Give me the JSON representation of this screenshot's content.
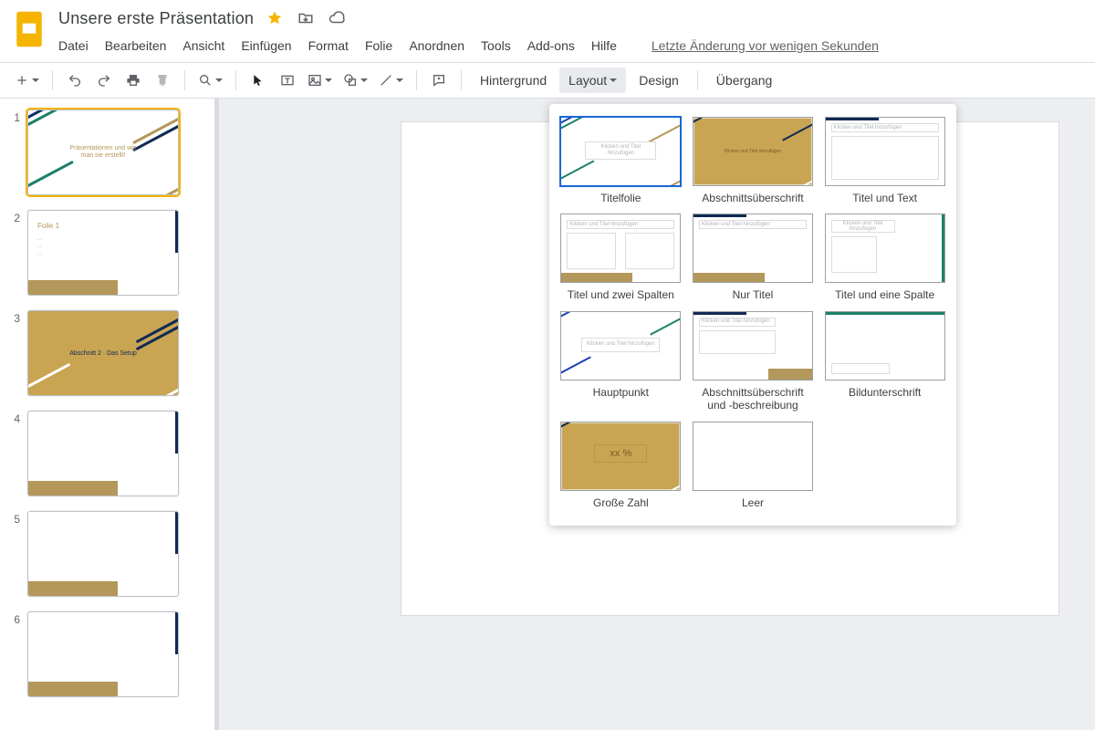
{
  "header": {
    "title": "Unsere erste Präsentation",
    "lastEdit": "Letzte Änderung vor wenigen Sekunden"
  },
  "menu": {
    "file": "Datei",
    "edit": "Bearbeiten",
    "view": "Ansicht",
    "insert": "Einfügen",
    "format": "Format",
    "slide": "Folie",
    "arrange": "Anordnen",
    "tools": "Tools",
    "addons": "Add-ons",
    "help": "Hilfe"
  },
  "toolbar": {
    "background": "Hintergrund",
    "layout": "Layout",
    "design": "Design",
    "transition": "Übergang"
  },
  "slides": {
    "s1_line1": "Präsentationen und wie",
    "s1_line2": "man sie erstellt!",
    "s2_title": "Folie 1",
    "s3_text": "Abschnitt 2 · Das Setup"
  },
  "layouts": {
    "ph_title": "Klicken und Titel hinzufügen",
    "ph_titleShort": "Klicken und Titel hinzufügen",
    "l1": "Titelfolie",
    "l2": "Abschnittsüberschrift",
    "l3": "Titel und Text",
    "l4": "Titel und zwei Spalten",
    "l5": "Nur Titel",
    "l6": "Titel und eine Spalte",
    "l7": "Hauptpunkt",
    "l8": "Abschnittsüberschrift und -beschreibung",
    "l9": "Bildunterschrift",
    "l10": "Große Zahl",
    "l10_num": "xx %",
    "l11": "Leer"
  },
  "slideNumbers": {
    "n1": "1",
    "n2": "2",
    "n3": "3",
    "n4": "4",
    "n5": "5",
    "n6": "6"
  }
}
